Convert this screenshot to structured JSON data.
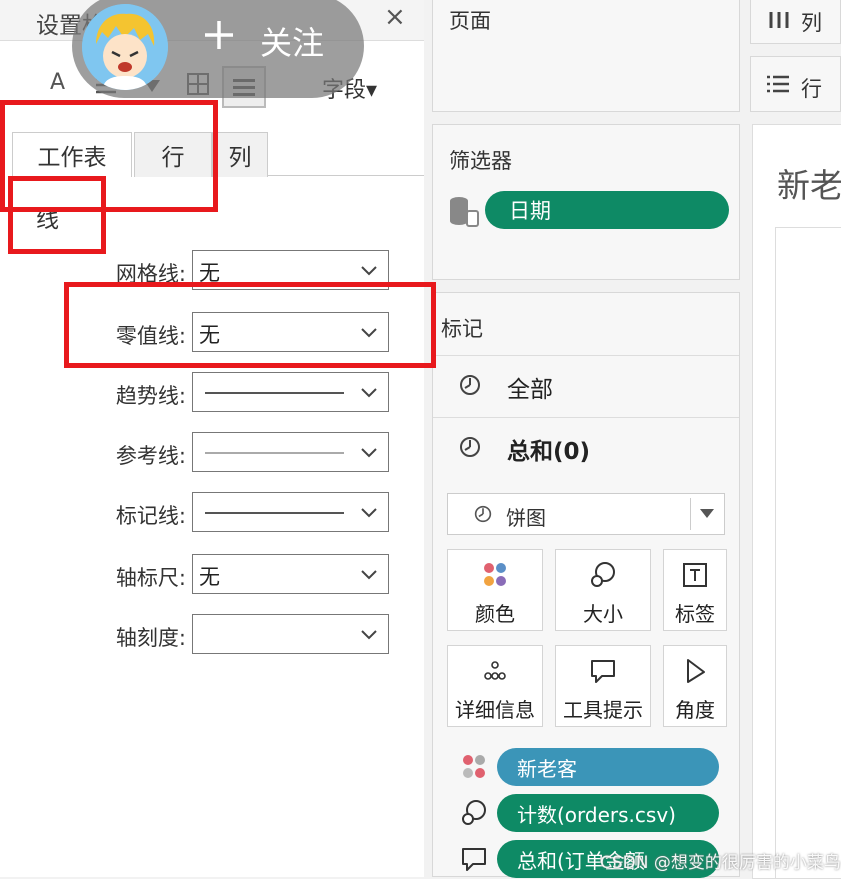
{
  "format_pane": {
    "title": "设置格",
    "close": "×",
    "toolbar": {
      "font_glyph": "A",
      "fields_label": "字段▾"
    },
    "tabs": [
      {
        "label": "工作表",
        "active": true
      },
      {
        "label": "行",
        "active": false
      },
      {
        "label": "列",
        "active": false
      }
    ],
    "section_label": "线",
    "settings": [
      {
        "label": "网格线:",
        "value": "无"
      },
      {
        "label": "零值线:",
        "value": "无"
      },
      {
        "label": "趋势线:",
        "value": ""
      },
      {
        "label": "参考线:",
        "value": ""
      },
      {
        "label": "标记线:",
        "value": ""
      },
      {
        "label": "轴标尺:",
        "value": "无"
      },
      {
        "label": "轴刻度:",
        "value": ""
      }
    ]
  },
  "shelves": {
    "pages_title": "页面",
    "filters_title": "筛选器",
    "filter_pill": "日期",
    "marks_title": "标记",
    "marks_rows": [
      {
        "label": "全部"
      },
      {
        "label": "总和(0)"
      }
    ],
    "mark_type": "饼图",
    "mark_buttons": [
      {
        "label": "颜色",
        "icon": "color-dots-icon"
      },
      {
        "label": "大小",
        "icon": "size-icon"
      },
      {
        "label": "标签",
        "icon": "text-label-icon"
      },
      {
        "label": "详细信息",
        "icon": "detail-dots-icon"
      },
      {
        "label": "工具提示",
        "icon": "tooltip-icon"
      },
      {
        "label": "角度",
        "icon": "angle-icon"
      }
    ],
    "fields": [
      {
        "label": "新老客",
        "color": "#3b95b8",
        "icon": "color-dots-icon"
      },
      {
        "label": "计数(orders.csv)",
        "color": "#0e8a65",
        "icon": "size-icon"
      },
      {
        "label": "总和(订单金额",
        "color": "#0e8a65",
        "icon": "tooltip-icon"
      }
    ]
  },
  "view": {
    "columns_label": "列",
    "rows_label": "行",
    "sheet_title": "新老"
  },
  "overlay": {
    "follow_label": "关注",
    "watermark": "CSDN @想变的很厉害的小菜鸟"
  },
  "colors": {
    "highlight_red": "#e8191d",
    "pill_green": "#0e8a65",
    "pill_blue": "#3b95b8"
  }
}
